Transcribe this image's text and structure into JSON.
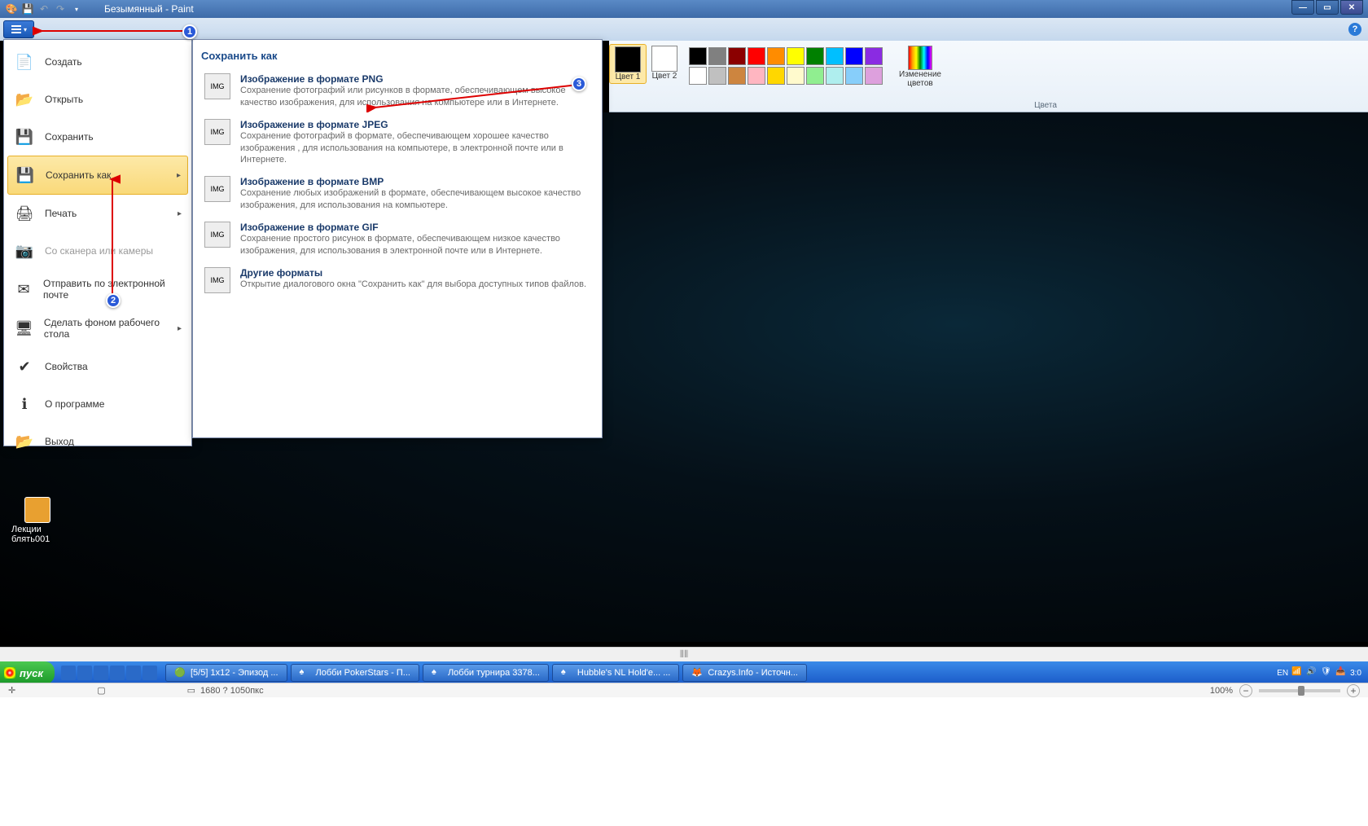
{
  "window": {
    "title": "Безымянный - Paint"
  },
  "file_menu": {
    "items": [
      {
        "label": "Создать",
        "icon": "new"
      },
      {
        "label": "Открыть",
        "icon": "open"
      },
      {
        "label": "Сохранить",
        "icon": "save"
      },
      {
        "label": "Сохранить как",
        "icon": "saveas",
        "selected": true,
        "submenu": true
      },
      {
        "label": "Печать",
        "icon": "print",
        "submenu": true
      },
      {
        "label": "Со сканера или камеры",
        "icon": "scanner",
        "disabled": true
      },
      {
        "label": "Отправить по электронной почте",
        "icon": "email"
      },
      {
        "label": "Сделать фоном рабочего стола",
        "icon": "wallpaper",
        "submenu": true
      },
      {
        "label": "Свойства",
        "icon": "properties"
      },
      {
        "label": "О программе",
        "icon": "about"
      },
      {
        "label": "Выход",
        "icon": "exit"
      }
    ]
  },
  "saveas": {
    "header": "Сохранить как",
    "formats": [
      {
        "title": "Изображение в формате PNG",
        "desc": "Сохранение фотографий или рисунков в формате, обеспечивающем высокое качество изображения, для использования на компьютере или в Интернете."
      },
      {
        "title": "Изображение в формате JPEG",
        "desc": "Сохранение фотографий в формате, обеспечивающем хорошее качество изображения , для использования на компьютере, в электронной почте или в Интернете."
      },
      {
        "title": "Изображение в формате BMP",
        "desc": "Сохранение любых изображений в формате, обеспечивающем высокое качество изображения, для использования на компьютере."
      },
      {
        "title": "Изображение в формате GIF",
        "desc": "Сохранение простого рисунок в формате, обеспечивающем низкое качество изображения, для использования в электронной почте или в Интернете."
      },
      {
        "title": "Другие форматы",
        "desc": "Открытие диалогового окна \"Сохранить как\" для выбора доступных типов файлов."
      }
    ]
  },
  "colors": {
    "color1_label": "Цвет 1",
    "color2_label": "Цвет 2",
    "color1_value": "#000000",
    "color2_value": "#ffffff",
    "edit_label": "Изменение цветов",
    "section_label": "Цвета",
    "row1": [
      "#000000",
      "#808080",
      "#8b0000",
      "#ff0000",
      "#ff8c00",
      "#ffff00",
      "#008000",
      "#00bfff",
      "#0000ff",
      "#8a2be2"
    ],
    "row2": [
      "#ffffff",
      "#c0c0c0",
      "#cd853f",
      "#ffb6c1",
      "#ffd700",
      "#fffacd",
      "#90ee90",
      "#afeeee",
      "#87cefa",
      "#dda0dd"
    ]
  },
  "desktop": {
    "icon_label": "Лекции блять001"
  },
  "taskbar": {
    "start": "пуск",
    "items": [
      "[5/5] 1x12 - Эпизод ...",
      "Лобби PokerStars - П...",
      "Лобби турнира 3378...",
      "Hubble's NL Hold'e... ...",
      "Crazys.Info - Источн..."
    ],
    "lang": "EN",
    "time": "3:0"
  },
  "statusbar": {
    "dims": "1680 ? 1050пкс",
    "zoom": "100%"
  },
  "annotations": {
    "n1": "1",
    "n2": "2",
    "n3": "3"
  }
}
